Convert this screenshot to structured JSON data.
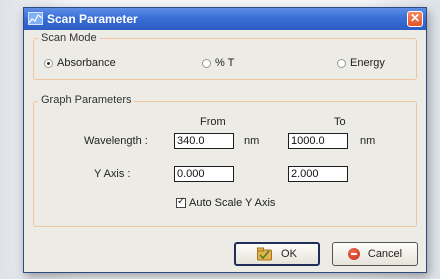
{
  "window": {
    "title": "Scan Parameter",
    "close_symbol": "✕"
  },
  "scan_mode": {
    "label": "Scan Mode",
    "options": [
      {
        "label": "Absorbance",
        "selected": true
      },
      {
        "label": "% T",
        "selected": false
      },
      {
        "label": "Energy",
        "selected": false
      }
    ]
  },
  "graph": {
    "label": "Graph Parameters",
    "col_from": "From",
    "col_to": "To",
    "wavelength_label": "Wavelength :",
    "wavelength_from": "340.0",
    "wavelength_to": "1000.0",
    "unit_from": "nm",
    "unit_to": "nm",
    "y_axis_label": "Y Axis :",
    "y_from": "0.000",
    "y_to": "2.000",
    "auto_scale_label": "Auto Scale Y Axis",
    "auto_scale_checked": true
  },
  "buttons": {
    "ok_label": "OK",
    "cancel_label": "Cancel"
  }
}
